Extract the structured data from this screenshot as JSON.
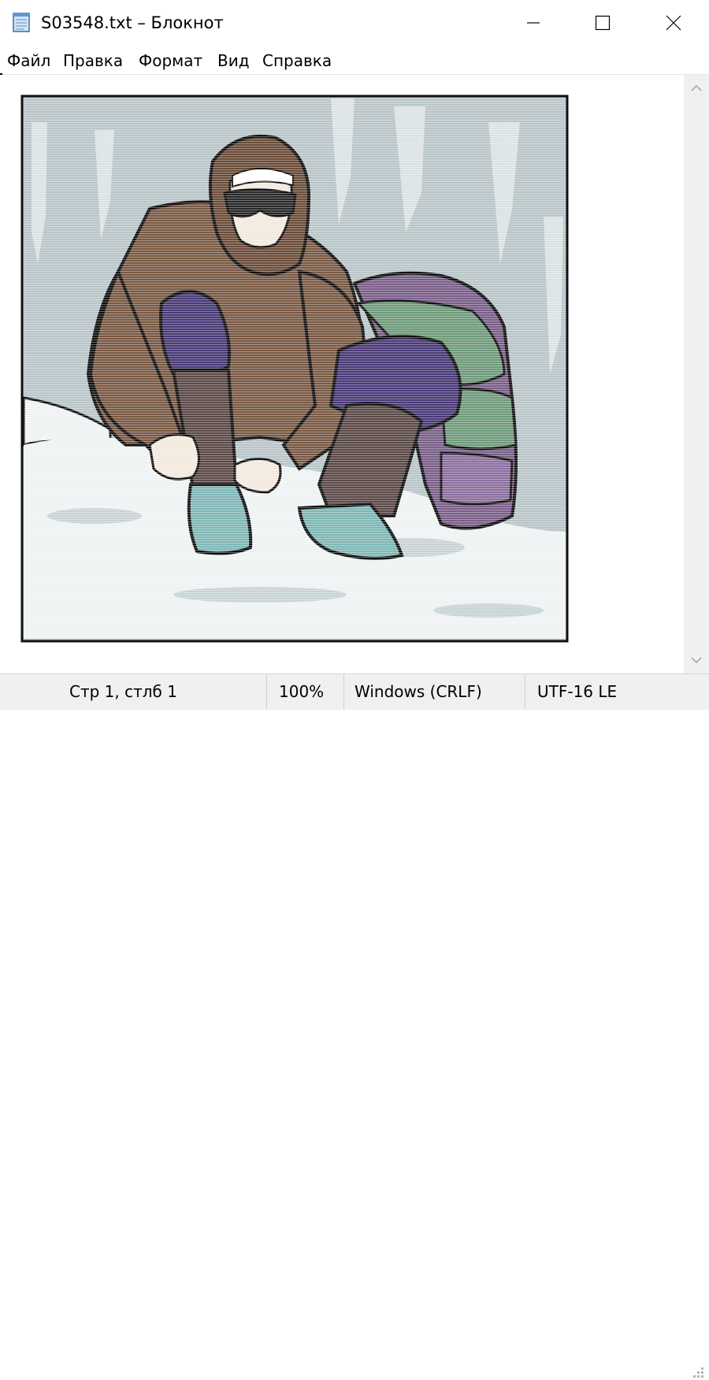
{
  "window": {
    "title": "S03548.txt – Блокнот",
    "controls": [
      "minimize",
      "maximize",
      "close"
    ]
  },
  "menu": {
    "items": [
      "Файл",
      "Правка",
      "Формат",
      "Вид",
      "Справка"
    ]
  },
  "editor": {
    "content": "ASCII-art image rendered as text",
    "icons": [
      "notepad-icon",
      "scroll-up-arrow-icon",
      "scroll-down-arrow-icon",
      "size-grip-icon"
    ]
  },
  "statusbar": {
    "position": "Стр 1, стлб 1",
    "zoom": "100%",
    "line_endings": "Windows (CRLF)",
    "encoding": "UTF-16 LE"
  },
  "colors": {
    "sky": "#b9c5c8",
    "coat": "#7a5a45",
    "trousers": "#4a3a78",
    "boots": "#5b4a48",
    "shoes": "#7fb7b5",
    "backpack_green": "#6f9a7a",
    "backpack_purple": "#7a5f88",
    "snow": "#eef2f2",
    "outline": "#111111"
  }
}
